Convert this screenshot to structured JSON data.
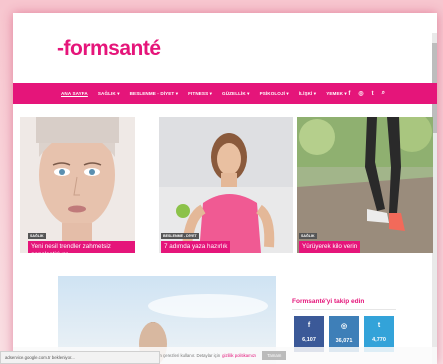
{
  "logo": "-formsanté",
  "nav": {
    "items": [
      "ANA SAYFA",
      "SAĞLIK ▾",
      "BESLENME - DİYET ▾",
      "FITNESS ▾",
      "GÜZELLİK ▾",
      "PSİKOLOJİ ▾",
      "İLİŞKİ ▾",
      "YEMEK ▾"
    ],
    "social": [
      "f",
      "◎",
      "t",
      "⌕"
    ]
  },
  "cards": [
    {
      "tag": "SAĞLIK",
      "caption": "Yeni nesil trendler zahmetsiz gençleştiriyor"
    },
    {
      "tag": "BESLENME - DİYET",
      "caption": "7 adımda yaza hazırlık"
    },
    {
      "tag": "SAĞLIK",
      "caption": "Yürüyerek kilo verin"
    }
  ],
  "sidebar": {
    "title": "Formsanté'yi takip edin",
    "boxes": [
      {
        "icon": "f",
        "count": "6,107",
        "color": "#3b5998"
      },
      {
        "icon": "◎",
        "count": "36,071",
        "color": "#3e7fb8"
      },
      {
        "icon": "t",
        "count": "4,770",
        "color": "#33a3d9"
      }
    ]
  },
  "cookie": {
    "text": "Bu web sitesi, size en iyi deneyimi sunmak için çerezleri kullanır. Detaylar için",
    "link": "gizlilik politikamızı",
    "ok": "Tamam"
  },
  "statusbar": "adservice.google.com.tr bekleniyor..."
}
